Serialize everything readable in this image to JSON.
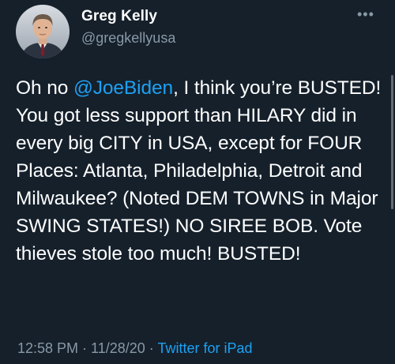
{
  "author": {
    "name": "Greg Kelly",
    "handle": "@gregkellyusa"
  },
  "more_menu": "•••",
  "tweet": {
    "text_before": "Oh no ",
    "mention": "@JoeBiden",
    "text_after": ", I think you’re BUSTED! You got less support than HILARY did in every big CITY in USA, except for FOUR Places:  Atlanta, Philadelphia, Detroit and Milwaukee? (Noted DEM TOWNS in Major SWING STATES!)  NO SIREE BOB.  Vote thieves stole too much! BUSTED!"
  },
  "meta": {
    "time": "12:58 PM",
    "separator": " · ",
    "date": "11/28/20",
    "separator2": " · ",
    "source": "Twitter for iPad"
  },
  "colors": {
    "background": "#15202b",
    "link": "#1da1f2",
    "secondary_text": "#8899a6"
  },
  "icons": {
    "more": "more-options-icon"
  }
}
